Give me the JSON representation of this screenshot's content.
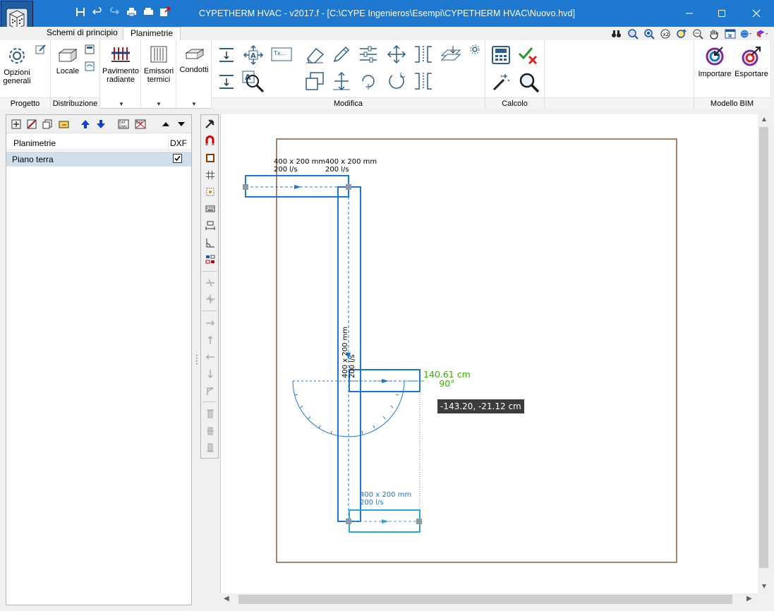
{
  "window": {
    "title": "CYPETHERM HVAC - v2017.f - [C:\\CYPE Ingenieros\\Esempi\\CYPETHERM HVAC\\Nuovo.hvd]"
  },
  "tabs": {
    "schemi": "Schemi di principio",
    "planimetrie": "Planimetrie"
  },
  "ribbon": {
    "progetto": {
      "label": "Progetto",
      "opzioni": "Opzioni generali"
    },
    "distribuzione": {
      "label": "Distribuzione",
      "locale": "Locale"
    },
    "pavimento": "Pavimento radiante",
    "emissori": "Emissori termici",
    "condotti": "Condotti",
    "modifica": "Modifica",
    "calcolo": "Calcolo",
    "bim": {
      "label": "Modello BIM",
      "importare": "Importare",
      "esportare": "Esportare"
    }
  },
  "left_panel": {
    "col_planimetrie": "Planimetrie",
    "col_dxf": "DXF",
    "rows": [
      {
        "name": "Piano terra",
        "dxf": true
      }
    ]
  },
  "drawing": {
    "duct1": {
      "dim": "400 x 200 mm",
      "flow": "200 l/s"
    },
    "duct2": {
      "dim": "400 x 200 mm",
      "flow": "200 l/s"
    },
    "duct3": {
      "dim": "400 x 200 mm",
      "flow": "200 l/s"
    },
    "duct4": {
      "dim": "400 x 200 mm",
      "flow": "200 l/s"
    },
    "length": "140.61 cm",
    "angle": "90°",
    "coords": "-143.20, -21.12 cm"
  },
  "colors": {
    "titlebar": "#1f78d0",
    "duct": "#1a78d4",
    "duct_selected": "#2aa6dc",
    "measure": "#38b000",
    "boundary": "#8a5a3a"
  }
}
